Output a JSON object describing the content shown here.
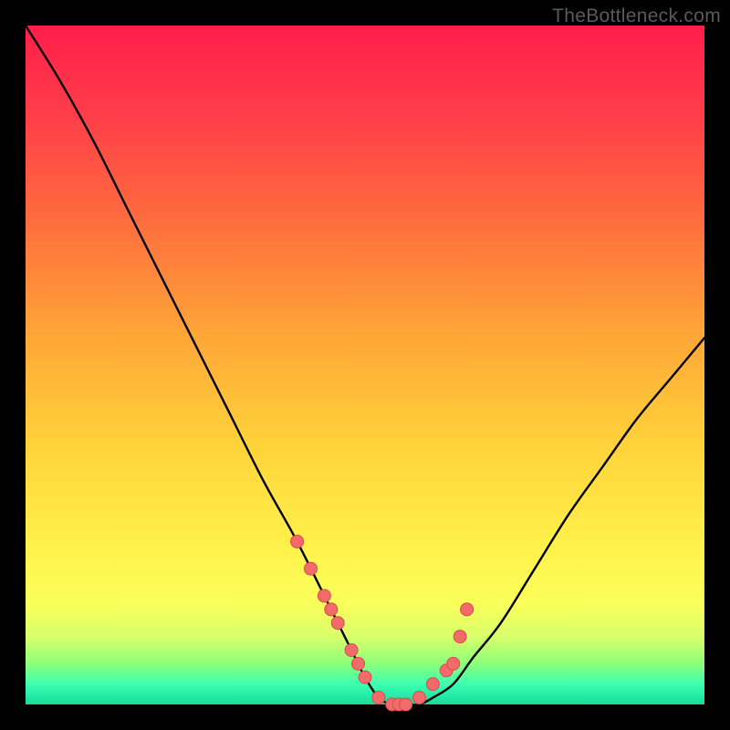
{
  "watermark": "TheBottleneck.com",
  "colors": {
    "frame": "#000000",
    "curve": "#000000",
    "dot_fill": "#f26a6a",
    "dot_stroke": "#d84c4c",
    "gradient_stops": [
      "#ff1e4a",
      "#ff3a4a",
      "#ff6a3e",
      "#ffa437",
      "#ffd33a",
      "#fff04a",
      "#fbff5a",
      "#d8ff6a",
      "#8cff7a",
      "#3effb0",
      "#20e8a6",
      "#1ed890"
    ]
  },
  "chart_data": {
    "type": "line",
    "title": "",
    "xlabel": "",
    "ylabel": "",
    "xlim": [
      0,
      100
    ],
    "ylim": [
      0,
      100
    ],
    "grid": false,
    "legend": false,
    "series": [
      {
        "name": "curve",
        "x": [
          0,
          5,
          10,
          15,
          20,
          25,
          30,
          35,
          40,
          45,
          48,
          50,
          52,
          54,
          56,
          58,
          60,
          63,
          66,
          70,
          75,
          80,
          85,
          90,
          95,
          100
        ],
        "y": [
          100,
          92,
          83,
          73,
          63,
          53,
          43,
          33,
          24,
          14,
          8,
          4,
          1,
          0,
          0,
          0,
          1,
          3,
          7,
          12,
          20,
          28,
          35,
          42,
          48,
          54
        ]
      }
    ],
    "dots": {
      "name": "highlighted-points",
      "x": [
        40,
        42,
        44,
        45,
        46,
        48,
        49,
        50,
        52,
        54,
        55,
        56,
        58,
        60,
        62,
        63,
        64,
        65
      ],
      "y": [
        24,
        20,
        16,
        14,
        12,
        8,
        6,
        4,
        1,
        0,
        0,
        0,
        1,
        3,
        5,
        6,
        10,
        14
      ]
    }
  }
}
